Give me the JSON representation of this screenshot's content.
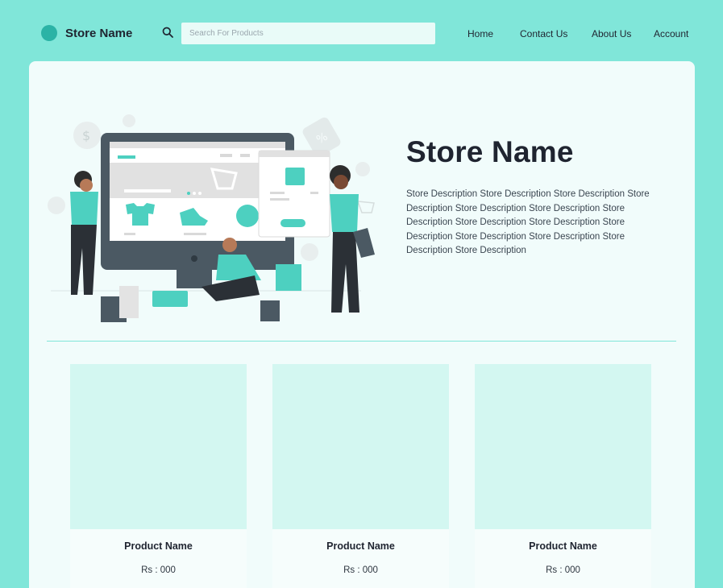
{
  "header": {
    "brand": "Store Name",
    "search": {
      "placeholder": "Search For Products",
      "value": ""
    },
    "nav": [
      {
        "label": "Home"
      },
      {
        "label": "Contact Us"
      },
      {
        "label": "About Us"
      },
      {
        "label": "Account"
      }
    ]
  },
  "hero": {
    "title": "Store Name",
    "description": "Store Description Store Description Store Description Store Description Store Description Store Description  Store Description Store Description Store Description Store Description Store Description Store Description Store Description Store Description"
  },
  "products": [
    {
      "name": "Product Name",
      "price": "Rs : 000"
    },
    {
      "name": "Product Name",
      "price": "Rs : 000"
    },
    {
      "name": "Product Name",
      "price": "Rs : 000"
    }
  ],
  "icons": {
    "search": "search-icon",
    "logo": "logo-icon"
  },
  "colors": {
    "background": "#80e6d9",
    "panel": "#f1fcfb",
    "accent": "#4dd0c0",
    "dark": "#1f2430",
    "card_image": "#d3f7f1"
  }
}
